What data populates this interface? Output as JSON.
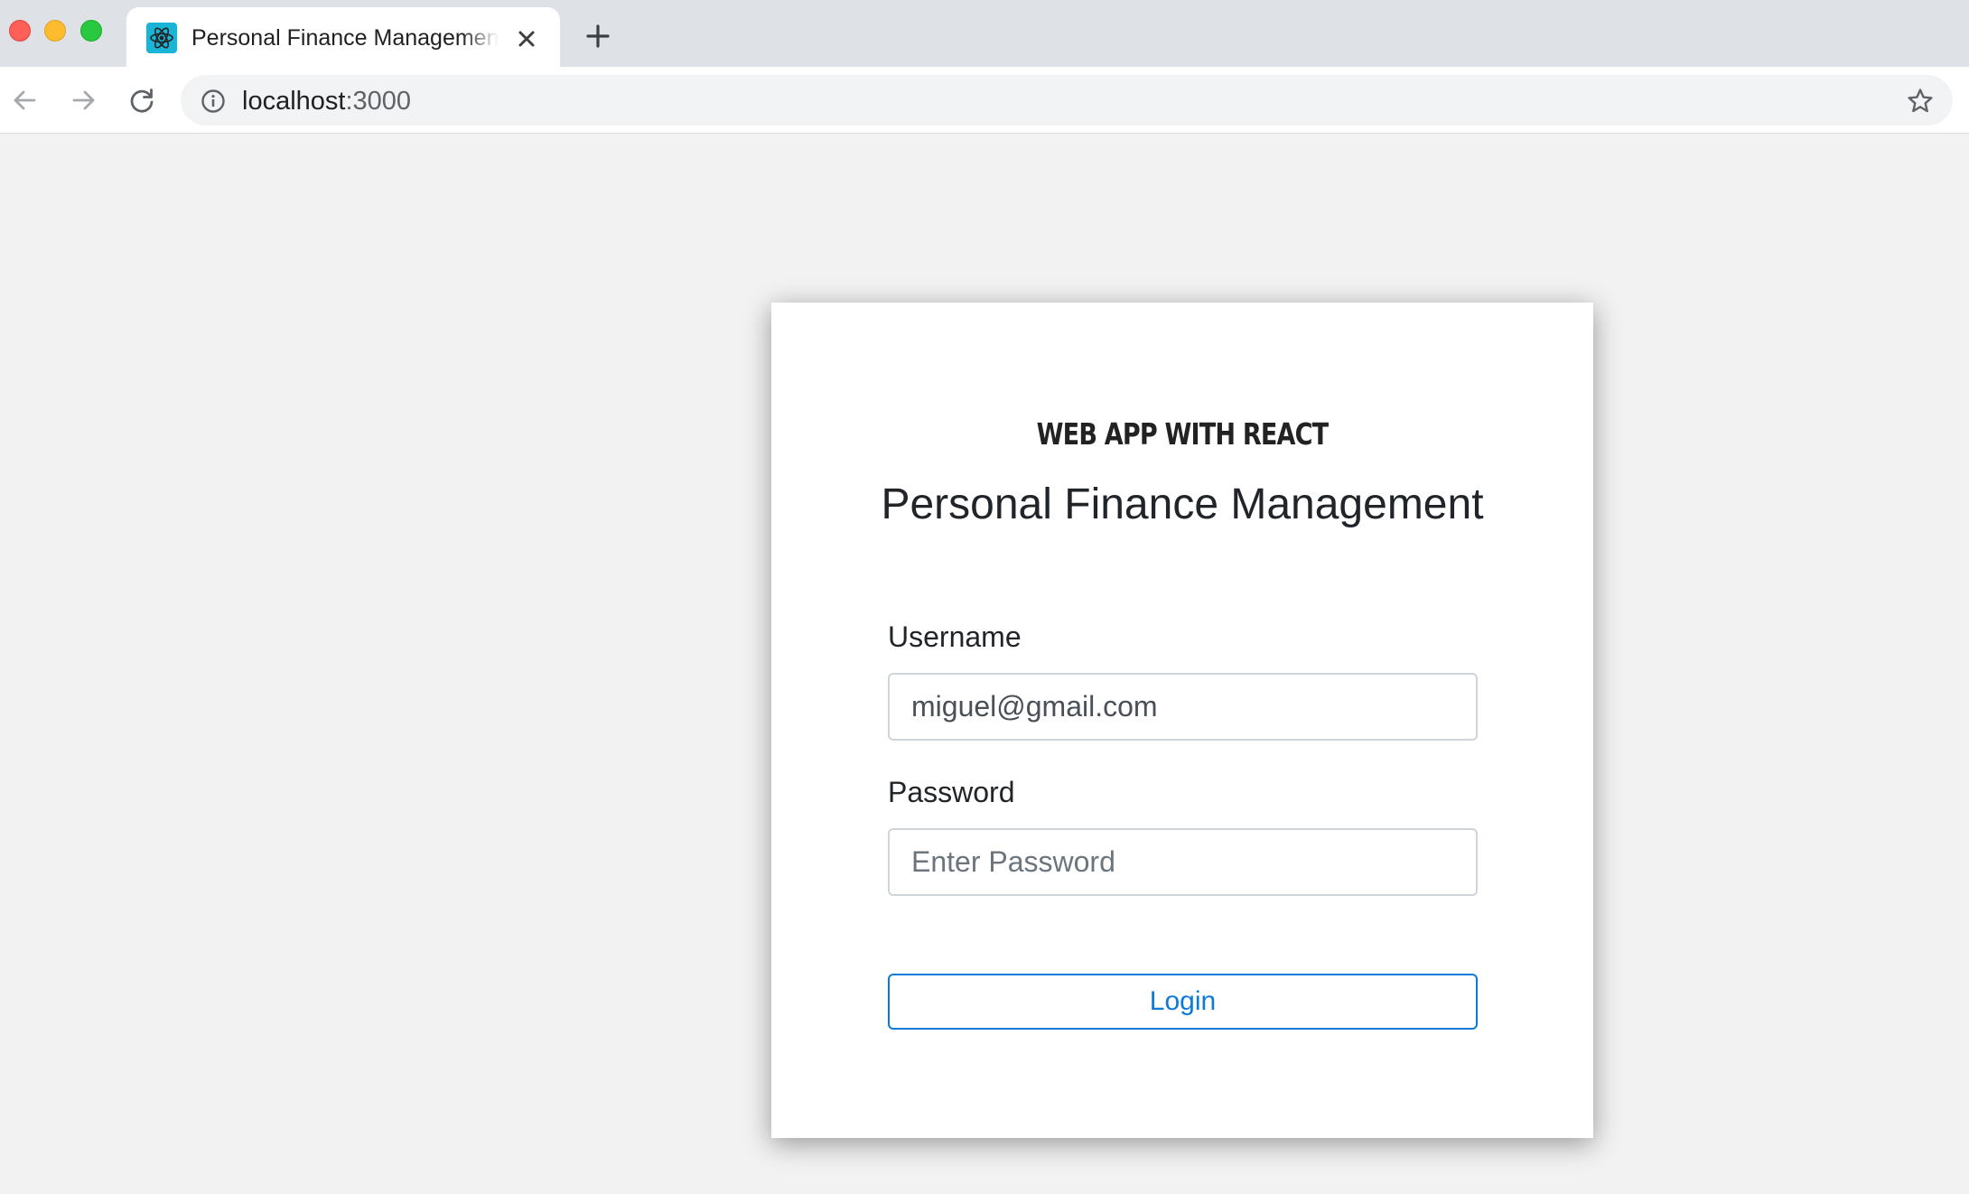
{
  "browser": {
    "tab": {
      "title": "Personal Finance Management",
      "favicon_icon": "react-logo-icon"
    },
    "address_bar": {
      "host": "localhost",
      "port": ":3000"
    },
    "icons": {
      "back": "arrow-left-icon",
      "forward": "arrow-right-icon",
      "reload": "reload-icon",
      "info": "info-icon",
      "bookmark": "star-icon",
      "close_tab": "close-icon",
      "new_tab": "plus-icon"
    }
  },
  "login": {
    "eyebrow": "WEB APP WITH REACT",
    "title": "Personal Finance Management",
    "username_label": "Username",
    "username_value": "miguel@gmail.com",
    "password_label": "Password",
    "password_placeholder": "Enter Password",
    "login_label": "Login"
  },
  "colors": {
    "page_background": "#f2f2f2",
    "primary": "#0d7ad8",
    "input_border": "#ced4da",
    "favicon": "#1ab4d7"
  }
}
